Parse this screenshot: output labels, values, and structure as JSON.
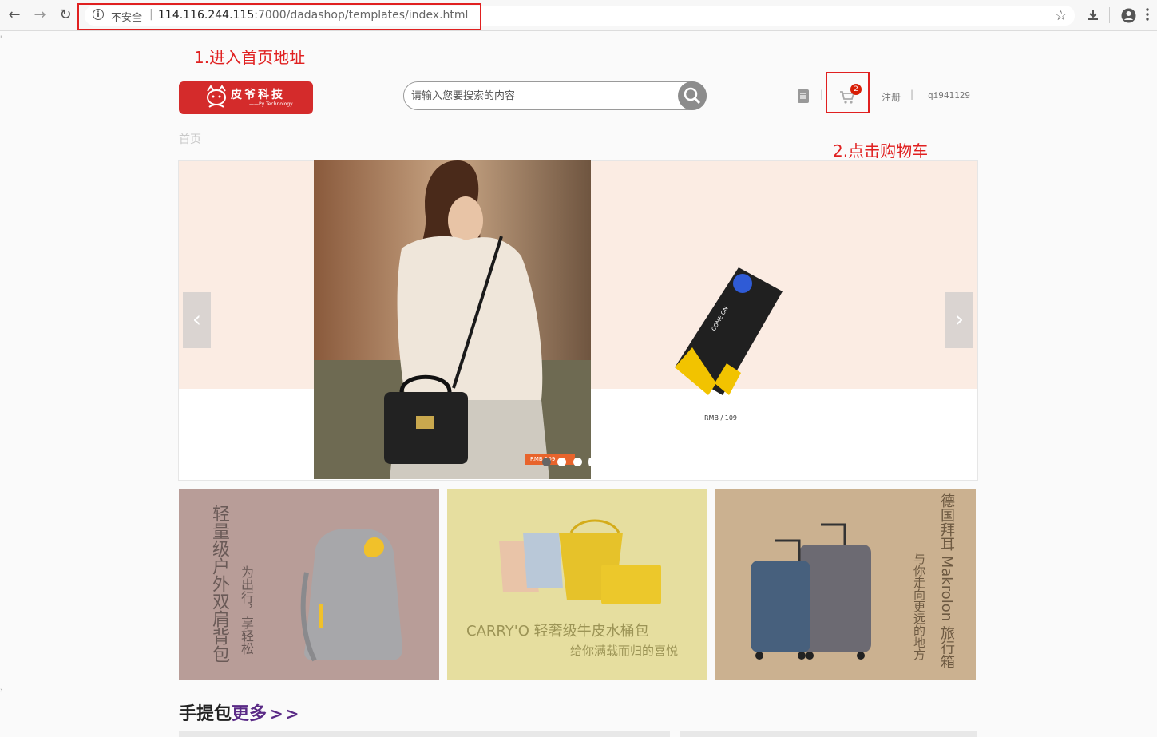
{
  "browser": {
    "security_label": "不安全",
    "url_host": "114.116.244.115",
    "url_path": ":7000/dadashop/templates/index.html"
  },
  "annotations": {
    "step1": "1.进入首页地址",
    "step2": "2.点击购物车"
  },
  "header": {
    "search_placeholder": "请输入您要搜索的内容",
    "cart_count": "2",
    "register_label": "注册",
    "username": "qi941129",
    "breadcrumb": "首页"
  },
  "banner": {
    "price_label": "RMB /   109",
    "tag_label": "RMB  109"
  },
  "promos": [
    {
      "title": "轻量级户外双肩背包",
      "subtitle": "为出行，享轻松",
      "bg": "#b89d98"
    },
    {
      "title": "CARRY'O 轻奢级牛皮水桶包",
      "subtitle": "给你满载而归的喜悦",
      "bg": "#e6de9f"
    },
    {
      "title": "德国拜耳 Makrolon 旅行箱",
      "subtitle": "与你走向更远的地方",
      "bg": "#cbb190"
    }
  ],
  "section": {
    "title": "手提包",
    "more": "更多",
    "arrows": ">>"
  }
}
